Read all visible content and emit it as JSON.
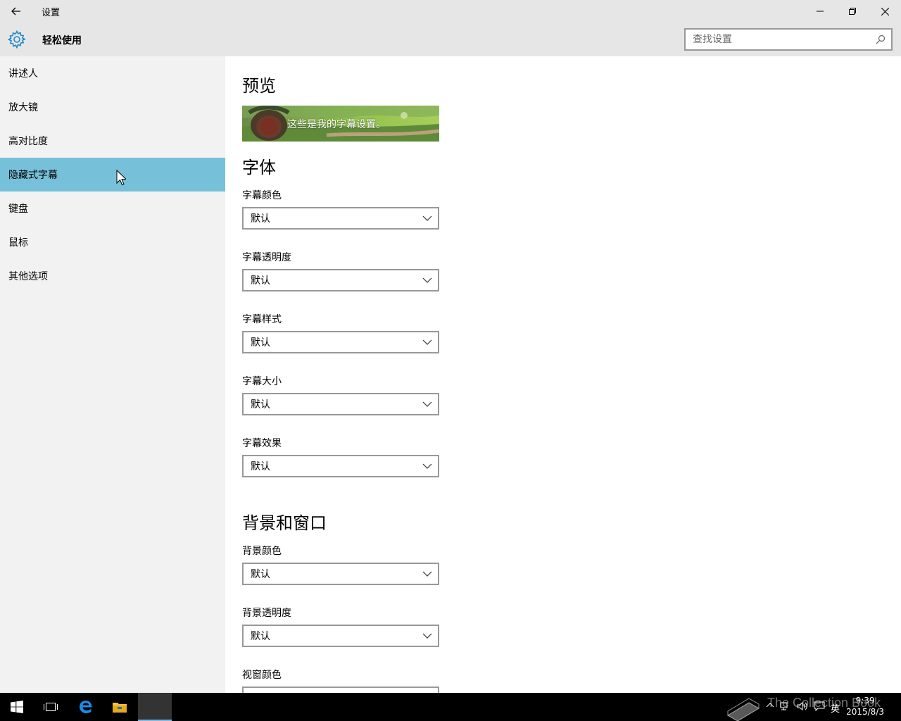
{
  "window": {
    "title": "设置",
    "header_title": "轻松使用"
  },
  "search": {
    "placeholder": "查找设置"
  },
  "sidebar": {
    "items": [
      {
        "label": "讲述人"
      },
      {
        "label": "放大镜"
      },
      {
        "label": "高对比度"
      },
      {
        "label": "隐藏式字幕"
      },
      {
        "label": "键盘"
      },
      {
        "label": "鼠标"
      },
      {
        "label": "其他选项"
      }
    ],
    "selected_index": 3
  },
  "main": {
    "preview_title": "预览",
    "preview_text": "这些是我的字幕设置。",
    "font_title": "字体",
    "font_fields": [
      {
        "label": "字幕颜色",
        "value": "默认"
      },
      {
        "label": "字幕透明度",
        "value": "默认"
      },
      {
        "label": "字幕样式",
        "value": "默认"
      },
      {
        "label": "字幕大小",
        "value": "默认"
      },
      {
        "label": "字幕效果",
        "value": "默认"
      }
    ],
    "bg_title": "背景和窗口",
    "bg_fields": [
      {
        "label": "背景颜色",
        "value": "默认"
      },
      {
        "label": "背景透明度",
        "value": "默认"
      },
      {
        "label": "视窗颜色",
        "value": ""
      }
    ]
  },
  "taskbar": {
    "time": "9:39",
    "date": "2015/8/3",
    "ime": "英",
    "watermark": "The Collection Book"
  },
  "colors": {
    "accent": "#76c0da",
    "titlebar_bg": "#e6e6e6",
    "sidebar_bg": "#f2f2f2",
    "taskbar_bg": "#000000"
  }
}
